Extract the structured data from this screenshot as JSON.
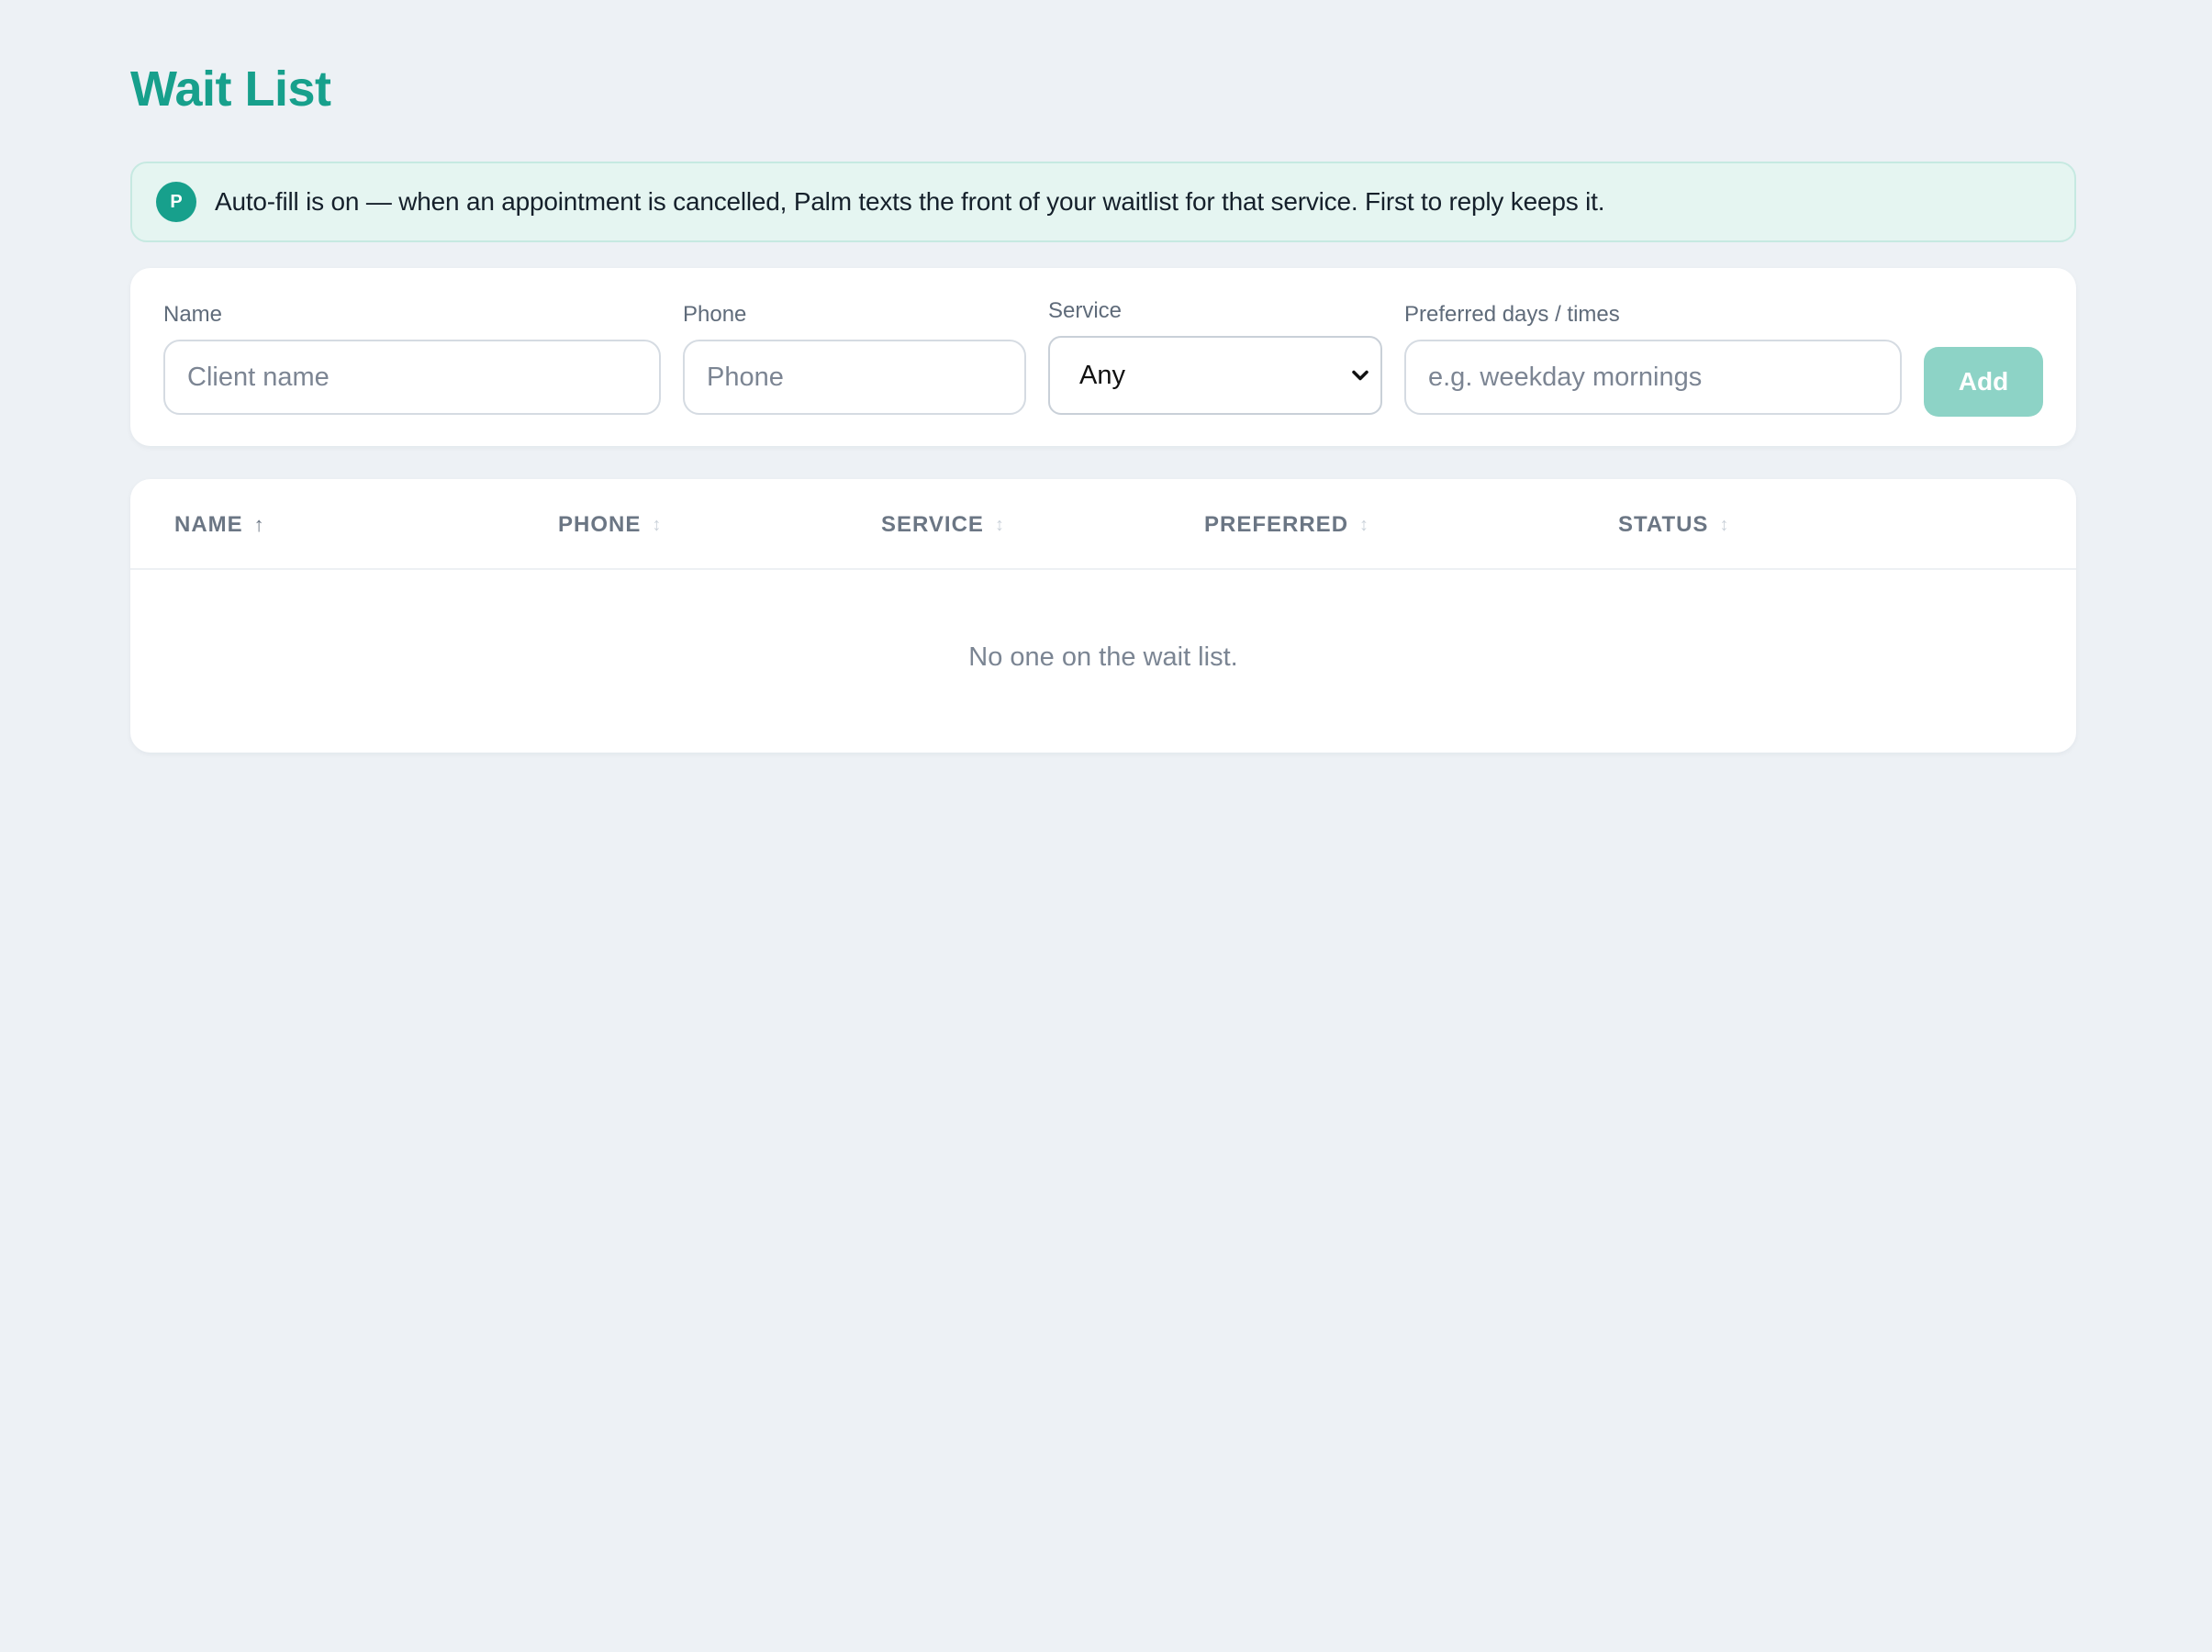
{
  "page": {
    "title": "Wait List"
  },
  "banner": {
    "avatar_letter": "P",
    "text": "Auto-fill is on — when an appointment is cancelled, Palm texts the front of your waitlist for that service. First to reply keeps it."
  },
  "form": {
    "name": {
      "label": "Name",
      "placeholder": "Client name",
      "value": ""
    },
    "phone": {
      "label": "Phone",
      "placeholder": "Phone",
      "value": ""
    },
    "service": {
      "label": "Service",
      "selected": "Any"
    },
    "preferred": {
      "label": "Preferred days / times",
      "placeholder": "e.g. weekday mornings",
      "value": ""
    },
    "add_label": "Add"
  },
  "table": {
    "columns": [
      {
        "label": "NAME",
        "sort": "ascending"
      },
      {
        "label": "PHONE",
        "sort": "none"
      },
      {
        "label": "SERVICE",
        "sort": "none"
      },
      {
        "label": "PREFERRED",
        "sort": "none"
      },
      {
        "label": "STATUS",
        "sort": "none"
      }
    ],
    "sort_icons": {
      "active": "↑",
      "idle": "↕"
    },
    "empty_message": "No one on the wait list."
  },
  "colors": {
    "accent": "#17a08c",
    "banner_bg": "#e5f5f1",
    "add_button_bg": "#8dd3c6",
    "page_bg": "#edf1f5"
  },
  "icons": {
    "sort_asc": "arrow-up-icon",
    "sort_none": "sort-icon",
    "select": "chevron-down-icon"
  }
}
